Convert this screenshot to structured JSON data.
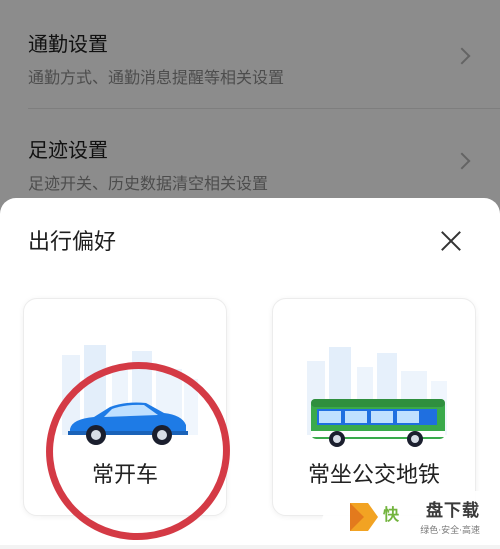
{
  "settings": {
    "items": [
      {
        "title": "通勤设置",
        "desc": "通勤方式、通勤消息提醒等相关设置"
      },
      {
        "title": "足迹设置",
        "desc": "足迹开关、历史数据清空相关设置"
      }
    ]
  },
  "sheet": {
    "title": "出行偏好",
    "options": [
      {
        "label": "常开车",
        "icon": "car-icon",
        "highlighted": true
      },
      {
        "label": "常坐公交地铁",
        "icon": "bus-icon",
        "highlighted": false
      }
    ]
  },
  "colors": {
    "highlight": "#d43a45",
    "car_body": "#1e7be6",
    "bus_green": "#3aaa4b",
    "bus_blue": "#1f6fe0"
  },
  "watermark": {
    "brand": "快",
    "title": "盘下载",
    "sub": "绿色·安全·高速"
  }
}
